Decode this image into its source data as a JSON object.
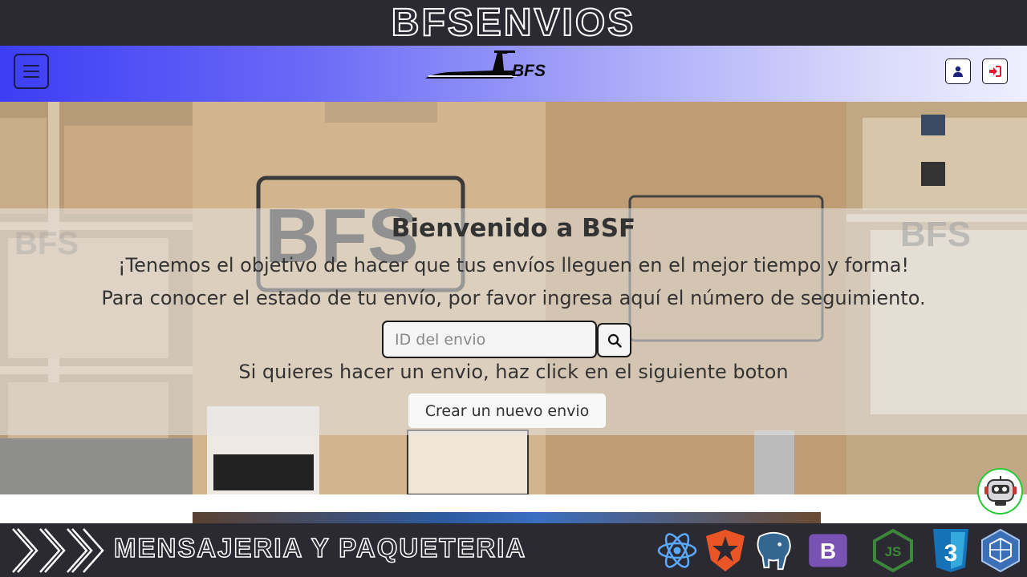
{
  "banner": {
    "title": "BFSENVIOS"
  },
  "navbar": {
    "logo_text": "BFS",
    "menu_icon": "hamburger-icon",
    "user_icon": "user-icon",
    "login_icon": "sign-in-icon"
  },
  "hero": {
    "title": "Bienvenido a BSF",
    "line1": "¡Tenemos el objetivo de hacer que tus envíos lleguen en el mejor tiempo y forma!",
    "line2": "Para conocer el estado de tu envío, por favor ingresa aquí el número de seguimiento.",
    "search_placeholder": "ID del envio",
    "search_icon": "search-icon",
    "line3": "Si quieres hacer un envio, haz click en el siguiente boton",
    "create_button": "Crear un nuevo envio",
    "box_brand": "BFS"
  },
  "chatbot": {
    "icon": "robot-icon"
  },
  "footer": {
    "text": "MENSAJERIA Y PAQUETERIA",
    "tech_icons": [
      "react-icon",
      "auth0-icon",
      "postgresql-icon",
      "bootstrap-icon",
      "nodejs-icon",
      "css3-icon",
      "sequelize-icon"
    ],
    "bootstrap_letter": "B",
    "node_label": "JS",
    "css_number": "3"
  },
  "colors": {
    "dark_bar": "#2b2a33",
    "nav_start": "#3d3df5",
    "nav_end": "#efefff",
    "login_red": "#e0192c",
    "user_navy": "#1a237e",
    "chatbot_ring": "#22cc33"
  }
}
